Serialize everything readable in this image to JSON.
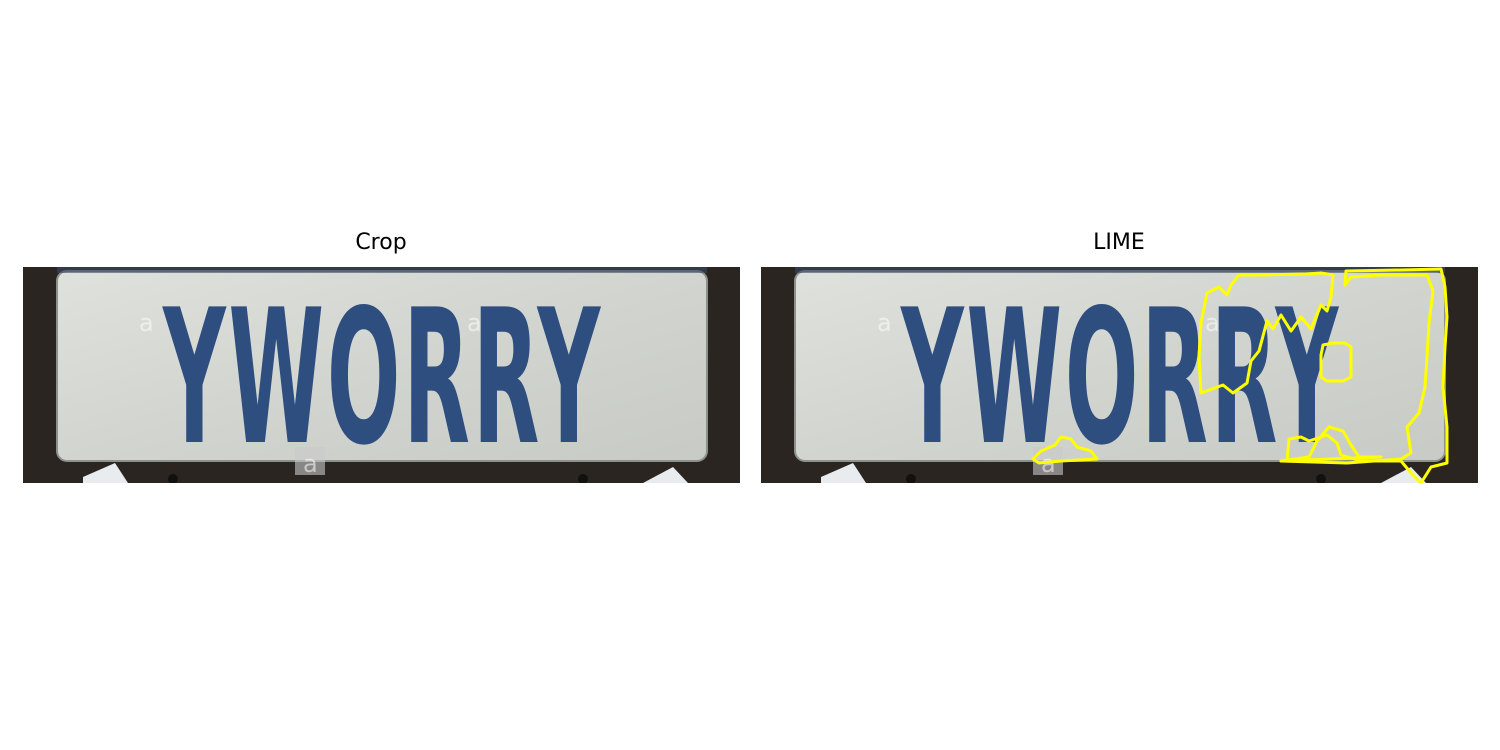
{
  "panels": [
    {
      "title": "Crop",
      "plate_text": "YWORRY",
      "overlay": false
    },
    {
      "title": "LIME",
      "plate_text": "YWORRY",
      "overlay": true
    }
  ],
  "watermark_letter": "a",
  "colors": {
    "plate_bg": "#d8dbd6",
    "plate_text": "#2f4e80",
    "frame": "#2a2520",
    "lime_outline": "#ffff00"
  }
}
